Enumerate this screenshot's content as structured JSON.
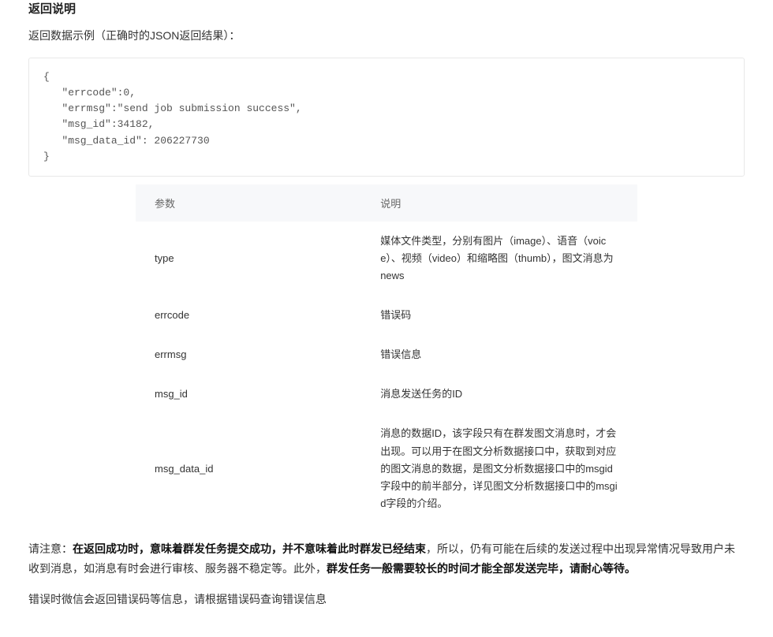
{
  "headings": {
    "return_title_fragment": "返回说明"
  },
  "intro_line": "返回数据示例（正确时的JSON返回结果）：",
  "code_lines": [
    "{",
    "   \"errcode\":0,",
    "   \"errmsg\":\"send job submission success\",",
    "   \"msg_id\":34182,",
    "   \"msg_data_id\": 206227730",
    "}"
  ],
  "table": {
    "header": {
      "param": "参数",
      "desc": "说明"
    },
    "rows": [
      {
        "param": "type",
        "desc": "媒体文件类型，分别有图片（image）、语音（voice）、视频（video）和缩略图（thumb），图文消息为news"
      },
      {
        "param": "errcode",
        "desc": "错误码"
      },
      {
        "param": "errmsg",
        "desc": "错误信息"
      },
      {
        "param": "msg_id",
        "desc": "消息发送任务的ID"
      },
      {
        "param": "msg_data_id",
        "desc": "消息的数据ID，该字段只有在群发图文消息时，才会出现。可以用于在图文分析数据接口中，获取到对应的图文消息的数据，是图文分析数据接口中的msgid字段中的前半部分，详见图文分析数据接口中的msgid字段的介绍。"
      }
    ]
  },
  "note": {
    "prefix": "请注意：",
    "bold1": "在返回成功时，意味着群发任务提交成功，并不意味着此时群发已经结束",
    "mid": "，所以，仍有可能在后续的发送过程中出现异常情况导致用户未收到消息，如消息有时会进行审核、服务器不稳定等。此外，",
    "bold2": "群发任务一般需要较长的时间才能全部发送完毕，请耐心等待。"
  },
  "err_line": "错误时微信会返回错误码等信息，请根据错误码查询错误信息"
}
